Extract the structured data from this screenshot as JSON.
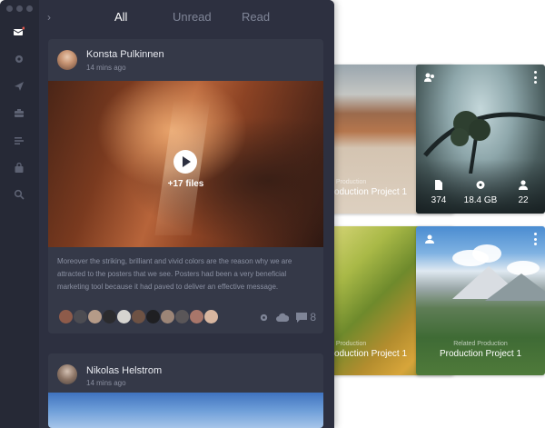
{
  "tabs": {
    "all": "All",
    "unread": "Unread",
    "read": "Read"
  },
  "post1": {
    "author": "Konsta Pulkinnen",
    "time": "14 mins ago",
    "file_count": "+17 files",
    "body": "Moreover the striking, brilliant and vivid colors are the reason why we are attracted to the posters that we see. Posters had been a very beneficial marketing tool because it had paved to deliver an effective message.",
    "comment_count": "8"
  },
  "post2": {
    "author": "Nikolas Helstrom",
    "time": "14 mins ago"
  },
  "cards": {
    "desert": {
      "title": "oduction Project 1",
      "sub": "d Production"
    },
    "tree": {
      "files": "374",
      "size": "18.4 GB",
      "members": "22"
    },
    "grass": {
      "title": "oduction Project 1",
      "sub": "d Production"
    },
    "mountain": {
      "title": "Production Project 1",
      "sub": "Related Production"
    }
  },
  "icons": [
    "inbox-icon",
    "notification-icon",
    "send-icon",
    "briefcase-icon",
    "list-icon",
    "lock-bag-icon",
    "search-icon",
    "play-icon",
    "gear-icon",
    "cloud-icon",
    "comment-icon",
    "file-icon",
    "disc-icon",
    "user-icon",
    "more-icon"
  ],
  "colors": {
    "sidebar": "#262936",
    "panel": "#2d3040",
    "card": "#353948",
    "text_muted": "#8a90a2"
  }
}
